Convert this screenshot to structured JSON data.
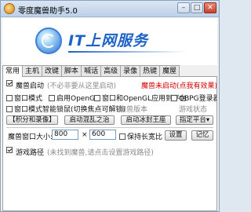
{
  "window": {
    "title": "零度魔兽助手5.0",
    "min": "–",
    "max": "□",
    "close": "✕"
  },
  "banner": {
    "text": "IT上网服务"
  },
  "tabs": [
    "常用",
    "主机",
    "改键",
    "脚本",
    "喊话",
    "高级",
    "录像",
    "热键",
    "魔屋"
  ],
  "row1": {
    "label": "魔兽启动",
    "hint": "(不必非要从这里启动)",
    "status": "魔兽未启动(点我有效果)"
  },
  "row2": {
    "windowed": "窗口模式",
    "opengl": "启用OpenGL",
    "window_opengl": "窗口和OpenGL应用到平台",
    "opengl_register": "OBPG登录器"
  },
  "row3": {
    "smart_lock": "窗口模式智能锁鼠(切换焦点可解锁)",
    "wc_version": "魔兽版本",
    "game_status": "游戏状态"
  },
  "row4": {
    "stats_btn": "【积分和录像】",
    "start_chaos": "启动混乱之治",
    "start_frozen": "启动冰封王座",
    "platform": "指定平台▾"
  },
  "row5": {
    "size_label": "魔兽窗口大小:",
    "width": "800",
    "x": "×",
    "height": "600",
    "keep_ratio": "保持长宽比",
    "settings": "设置",
    "remember": "记忆"
  },
  "row6": {
    "label": "游戏路径",
    "path": "(未找到魔兽,请点击设置游戏路径)"
  }
}
